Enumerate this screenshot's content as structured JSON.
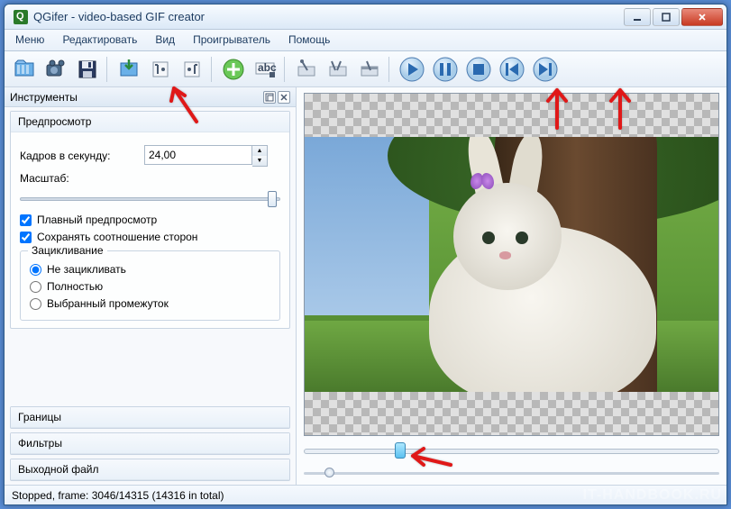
{
  "window": {
    "title": "QGifer - video-based GIF creator"
  },
  "menu": {
    "items": [
      "Меню",
      "Редактировать",
      "Вид",
      "Проигрыватель",
      "Помощь"
    ]
  },
  "toolbar": {
    "open_icon": "film-open",
    "open_video_icon": "camera",
    "save_icon": "floppy",
    "import1_icon": "arrow-down-box",
    "pos_left_icon": "bracket-left",
    "pos_right_icon": "bracket-right",
    "add_icon": "plus-circle",
    "text_icon": "abc",
    "cut1_icon": "tool1",
    "cut2_icon": "tool2",
    "cut3_icon": "tool3"
  },
  "player": {
    "play": "play",
    "pause": "pause",
    "stop": "stop",
    "prev": "prev",
    "next": "next"
  },
  "panel": {
    "title": "Инструменты",
    "sections": {
      "preview": "Предпросмотр",
      "bounds": "Границы",
      "filters": "Фильтры",
      "output": "Выходной файл"
    },
    "fps_label": "Кадров в секунду:",
    "fps_value": "24,00",
    "scale_label": "Масштаб:",
    "smooth_label": "Плавный предпросмотр",
    "smooth_checked": true,
    "aspect_label": "Сохранять соотношение сторон",
    "aspect_checked": true,
    "loop_group": "Зацикливание",
    "loop_options": [
      "Не зацикливать",
      "Полностью",
      "Выбранный промежуток"
    ],
    "loop_selected": 0
  },
  "video": {
    "range_thumb_pct": 22,
    "pos_dot_pct": 5
  },
  "status": {
    "text": "Stopped, frame: 3046/14315 (14316 in total)"
  },
  "watermark": "IT-HANDBOOK.RU"
}
